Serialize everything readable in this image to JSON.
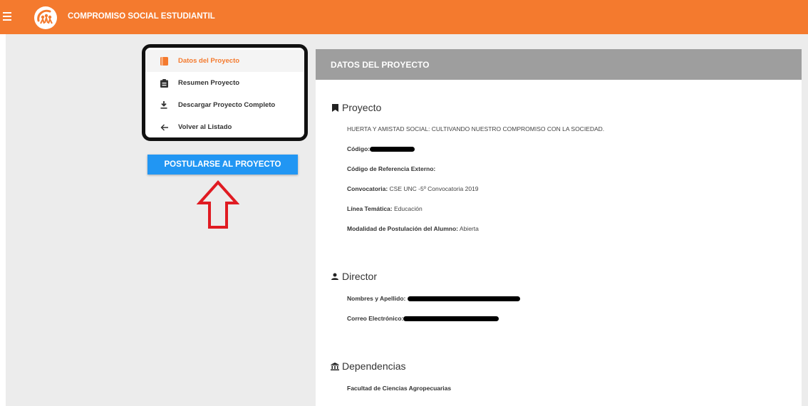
{
  "header": {
    "title": "COMPROMISO SOCIAL ESTUDIANTIL"
  },
  "menu": {
    "items": [
      {
        "label": "Datos del Proyecto",
        "icon": "bookmark-icon",
        "active": true
      },
      {
        "label": "Resumen Proyecto",
        "icon": "clipboard-icon",
        "active": false
      },
      {
        "label": "Descargar Proyecto Completo",
        "icon": "download-icon",
        "active": false
      },
      {
        "label": "Volver al Listado",
        "icon": "arrow-left-icon",
        "active": false
      }
    ]
  },
  "apply_button": {
    "label": "POSTULARSE AL PROYECTO"
  },
  "panel": {
    "title": "DATOS DEL PROYECTO",
    "proyecto": {
      "heading": "Proyecto",
      "name": "HUERTA Y AMISTAD SOCIAL: CULTIVANDO NUESTRO COMPROMISO CON LA SOCIEDAD.",
      "codigo_label": "Código:",
      "ref_label": "Código de Referencia Externo:",
      "convocatoria_label": "Convocatoria:",
      "convocatoria_value": "CSE UNC -5º Convocatoria 2019",
      "linea_label": "Línea Temática:",
      "linea_value": "Educación",
      "modalidad_label": "Modalidad de Postulación del Alumno:",
      "modalidad_value": "Abierta"
    },
    "director": {
      "heading": "Director",
      "nombres_label": "Nombres y Apellido:",
      "correo_label": "Correo Electrónico:"
    },
    "dependencias": {
      "heading": "Dependencias",
      "value": "Facultad de Ciencias Agropecuarias"
    }
  },
  "colors": {
    "header": "#f47a2e",
    "button": "#2196f3",
    "panel_header": "#9e9e9e",
    "annotation": "#e01b22"
  }
}
